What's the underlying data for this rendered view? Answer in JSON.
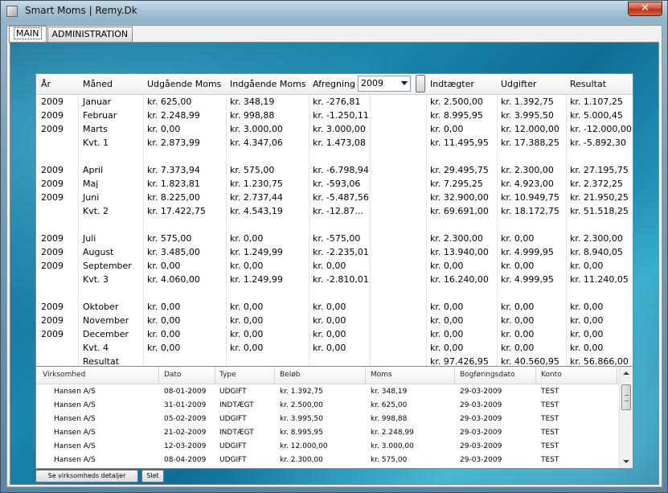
{
  "window": {
    "title": "Smart Moms  |  Remy.Dk",
    "close_label": "✕"
  },
  "tabs": [
    {
      "label": "MAIN"
    },
    {
      "label": "ADMINISTRATION"
    }
  ],
  "summary": {
    "headers": {
      "year": "År",
      "month": "Måned",
      "out_vat": "Udgående Moms",
      "in_vat": "Indgående Moms",
      "settlement": "Afregning",
      "income": "Indtægter",
      "expenses": "Udgifter",
      "result": "Resultat"
    },
    "year_select": {
      "value": "2009"
    },
    "rows": [
      {
        "year": "2009",
        "month": "Januar",
        "out": "kr. 625,00",
        "in": "kr. 348,19",
        "settle": "kr. -276,81",
        "income": "kr. 2.500,00",
        "exp": "kr. 1.392,75",
        "res": "kr. 1.107,25"
      },
      {
        "year": "2009",
        "month": "Februar",
        "out": "kr. 2.248,99",
        "in": "kr. 998,88",
        "settle": "kr. -1.250,11",
        "income": "kr. 8.995,95",
        "exp": "kr. 3.995,50",
        "res": "kr. 5.000,45"
      },
      {
        "year": "2009",
        "month": "Marts",
        "out": "kr. 0,00",
        "in": "kr. 3.000,00",
        "settle": "kr. 3.000,00",
        "income": "kr. 0,00",
        "exp": "kr. 12.000,00",
        "res": "kr. -12.000,00"
      },
      {
        "year": "",
        "month": "Kvt. 1",
        "out": "kr. 2.873,99",
        "in": "kr. 4.347,06",
        "settle": "kr. 1.473,08",
        "income": "kr. 11.495,95",
        "exp": "kr. 17.388,25",
        "res": "kr. -5.892,30"
      },
      {
        "year": "",
        "month": "",
        "out": "",
        "in": "",
        "settle": "",
        "income": "",
        "exp": "",
        "res": ""
      },
      {
        "year": "2009",
        "month": "April",
        "out": "kr. 7.373,94",
        "in": "kr. 575,00",
        "settle": "kr. -6.798,94",
        "income": "kr. 29.495,75",
        "exp": "kr. 2.300,00",
        "res": "kr. 27.195,75"
      },
      {
        "year": "2009",
        "month": "Maj",
        "out": "kr. 1.823,81",
        "in": "kr. 1.230,75",
        "settle": "kr. -593,06",
        "income": "kr. 7.295,25",
        "exp": "kr. 4.923,00",
        "res": "kr. 2.372,25"
      },
      {
        "year": "2009",
        "month": "Juni",
        "out": "kr. 8.225,00",
        "in": "kr. 2.737,44",
        "settle": "kr. -5.487,56",
        "income": "kr. 32.900,00",
        "exp": "kr. 10.949,75",
        "res": "kr. 21.950,25"
      },
      {
        "year": "",
        "month": "Kvt. 2",
        "out": "kr. 17.422,75",
        "in": "kr. 4.543,19",
        "settle": "kr. -12.87...",
        "income": "kr. 69.691,00",
        "exp": "kr. 18.172,75",
        "res": "kr. 51.518,25"
      },
      {
        "year": "",
        "month": "",
        "out": "",
        "in": "",
        "settle": "",
        "income": "",
        "exp": "",
        "res": ""
      },
      {
        "year": "2009",
        "month": "Juli",
        "out": "kr. 575,00",
        "in": "kr. 0,00",
        "settle": "kr. -575,00",
        "income": "kr. 2.300,00",
        "exp": "kr. 0,00",
        "res": "kr. 2.300,00"
      },
      {
        "year": "2009",
        "month": "August",
        "out": "kr. 3.485,00",
        "in": "kr. 1.249,99",
        "settle": "kr. -2.235,01",
        "income": "kr. 13.940,00",
        "exp": "kr. 4.999,95",
        "res": "kr. 8.940,05"
      },
      {
        "year": "2009",
        "month": "September",
        "out": "kr. 0,00",
        "in": "kr. 0,00",
        "settle": "kr. 0,00",
        "income": "kr. 0,00",
        "exp": "kr. 0,00",
        "res": "kr. 0,00"
      },
      {
        "year": "",
        "month": "Kvt. 3",
        "out": "kr. 4.060,00",
        "in": "kr. 1.249,99",
        "settle": "kr. -2.810,01",
        "income": "kr. 16.240,00",
        "exp": "kr. 4.999,95",
        "res": "kr. 11.240,05"
      },
      {
        "year": "",
        "month": "",
        "out": "",
        "in": "",
        "settle": "",
        "income": "",
        "exp": "",
        "res": ""
      },
      {
        "year": "2009",
        "month": "Oktober",
        "out": "kr. 0,00",
        "in": "kr. 0,00",
        "settle": "kr. 0,00",
        "income": "kr. 0,00",
        "exp": "kr. 0,00",
        "res": "kr. 0,00"
      },
      {
        "year": "2009",
        "month": "November",
        "out": "kr. 0,00",
        "in": "kr. 0,00",
        "settle": "kr. 0,00",
        "income": "kr. 0,00",
        "exp": "kr. 0,00",
        "res": "kr. 0,00"
      },
      {
        "year": "2009",
        "month": "December",
        "out": "kr. 0,00",
        "in": "kr. 0,00",
        "settle": "kr. 0,00",
        "income": "kr. 0,00",
        "exp": "kr. 0,00",
        "res": "kr. 0,00"
      },
      {
        "year": "",
        "month": "Kvt. 4",
        "out": "kr. 0,00",
        "in": "kr. 0,00",
        "settle": "kr. 0,00",
        "income": "kr. 0,00",
        "exp": "kr. 0,00",
        "res": "kr. 0,00"
      },
      {
        "year": "",
        "month": "Resultat",
        "out": "",
        "in": "",
        "settle": "",
        "income": "kr. 97.426,95",
        "exp": "kr. 40.560,95",
        "res": "kr. 56.866,00"
      }
    ]
  },
  "detail": {
    "headers": {
      "company": "Virksomhed",
      "date": "Dato",
      "type": "Type",
      "amount": "Beløb",
      "vat": "Moms",
      "booking": "Bogføringsdato",
      "account": "Konto"
    },
    "rows": [
      {
        "company": "Hansen A/S",
        "date": "08-01-2009",
        "type": "UDGIFT",
        "amount": "kr. 1.392,75",
        "vat": "kr. 348,19",
        "booking": "29-03-2009",
        "account": "TEST"
      },
      {
        "company": "Hansen A/S",
        "date": "31-01-2009",
        "type": "INDTÆGT",
        "amount": "kr. 2.500,00",
        "vat": "kr. 625,00",
        "booking": "29-03-2009",
        "account": "TEST"
      },
      {
        "company": "Hansen A/S",
        "date": "05-02-2009",
        "type": "UDGIFT",
        "amount": "kr. 3.995,50",
        "vat": "kr. 998,88",
        "booking": "29-03-2009",
        "account": "TEST"
      },
      {
        "company": "Hansen A/S",
        "date": "21-02-2009",
        "type": "INDTÆGT",
        "amount": "kr. 8.995,95",
        "vat": "kr. 2.248,99",
        "booking": "29-03-2009",
        "account": "TEST"
      },
      {
        "company": "Hansen A/S",
        "date": "12-03-2009",
        "type": "UDGIFT",
        "amount": "kr. 12.000,00",
        "vat": "kr. 3.000,00",
        "booking": "29-03-2009",
        "account": "TEST"
      },
      {
        "company": "Hansen A/S",
        "date": "08-04-2009",
        "type": "UDGIFT",
        "amount": "kr. 2.300,00",
        "vat": "kr. 575,00",
        "booking": "29-03-2009",
        "account": "TEST"
      }
    ]
  },
  "buttons": {
    "details": "Se virksomheds detaljer",
    "delete": "Slet"
  }
}
